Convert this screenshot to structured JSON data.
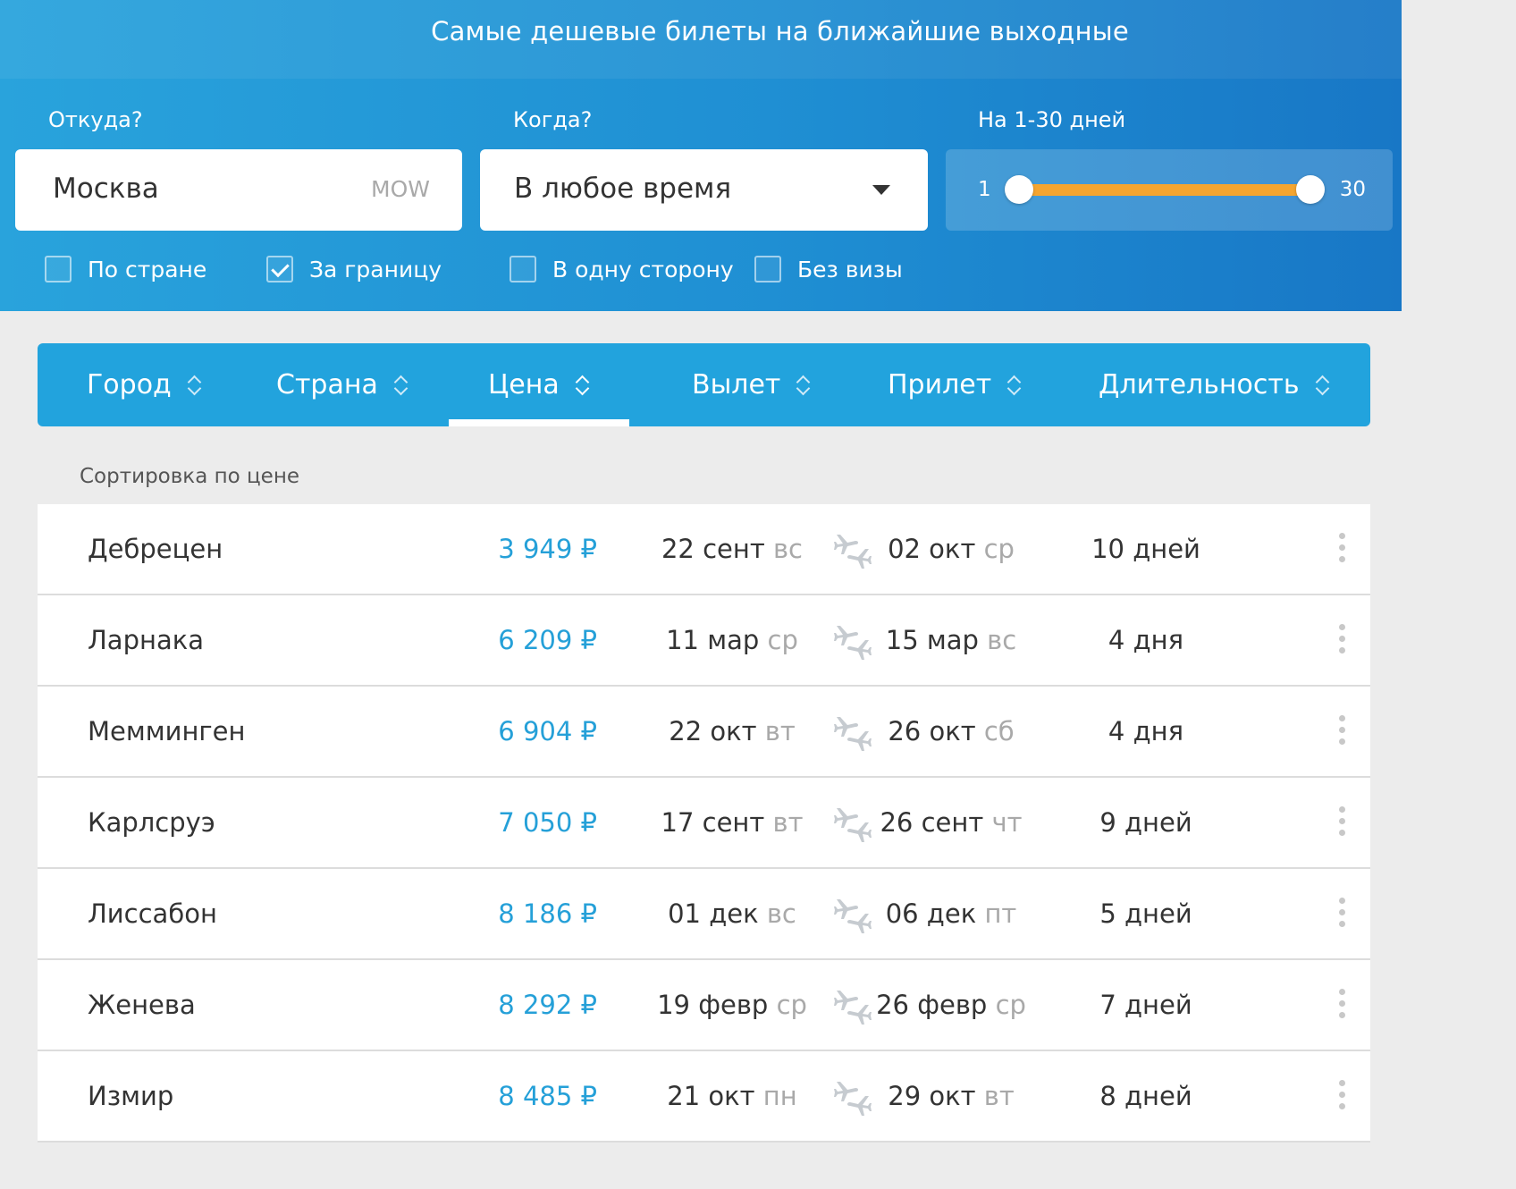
{
  "header": {
    "title": "Самые дешевые билеты на ближайшие выходные"
  },
  "filters": {
    "from": {
      "label": "Откуда?",
      "value": "Москва",
      "code": "MOW"
    },
    "when": {
      "label": "Когда?",
      "value": "В любое время"
    },
    "duration": {
      "label": "На 1-30 дней",
      "min": "1",
      "max": "30",
      "range_from": 1,
      "range_to": 30
    },
    "checkboxes": [
      {
        "label": "По стране",
        "checked": false
      },
      {
        "label": "За границу",
        "checked": true
      },
      {
        "label": "В одну сторону",
        "checked": false
      },
      {
        "label": "Без визы",
        "checked": false
      }
    ]
  },
  "tabs": [
    {
      "label": "Город"
    },
    {
      "label": "Страна"
    },
    {
      "label": "Цена",
      "active": true
    },
    {
      "label": "Вылет"
    },
    {
      "label": "Прилет"
    },
    {
      "label": "Длительность"
    }
  ],
  "sort_caption": "Сортировка по цене",
  "results": [
    {
      "city": "Дебрецен",
      "price": "3 949 ₽",
      "dep_date": "22 сент",
      "dep_day": "вс",
      "arr_date": "02 окт",
      "arr_day": "ср",
      "duration": "10 дней"
    },
    {
      "city": "Ларнака",
      "price": "6 209 ₽",
      "dep_date": "11 мар",
      "dep_day": "ср",
      "arr_date": "15 мар",
      "arr_day": "вс",
      "duration": "4 дня"
    },
    {
      "city": "Мемминген",
      "price": "6 904 ₽",
      "dep_date": "22 окт",
      "dep_day": "вт",
      "arr_date": "26 окт",
      "arr_day": "сб",
      "duration": "4 дня"
    },
    {
      "city": "Карлсруэ",
      "price": "7 050 ₽",
      "dep_date": "17 сент",
      "dep_day": "вт",
      "arr_date": "26 сент",
      "arr_day": "чт",
      "duration": "9 дней"
    },
    {
      "city": "Лиссабон",
      "price": "8 186 ₽",
      "dep_date": "01 дек",
      "dep_day": "вс",
      "arr_date": "06 дек",
      "arr_day": "пт",
      "duration": "5 дней"
    },
    {
      "city": "Женева",
      "price": "8 292 ₽",
      "dep_date": "19 февр",
      "dep_day": "ср",
      "arr_date": "26 февр",
      "arr_day": "ср",
      "duration": "7 дней"
    },
    {
      "city": "Измир",
      "price": "8 485 ₽",
      "dep_date": "21 окт",
      "dep_day": "пн",
      "arr_date": "29 окт",
      "arr_day": "вт",
      "duration": "8 дней"
    }
  ],
  "icons": {
    "roundtrip": "roundtrip-plane-icon",
    "more": "more-vertical-icon",
    "sort": "sort-chevrons-icon",
    "dropdown": "caret-down-icon"
  },
  "colors": {
    "header": "#1f8fd3",
    "accent": "#22a3dd",
    "price": "#25a0d8",
    "slider": "#f5a530"
  }
}
